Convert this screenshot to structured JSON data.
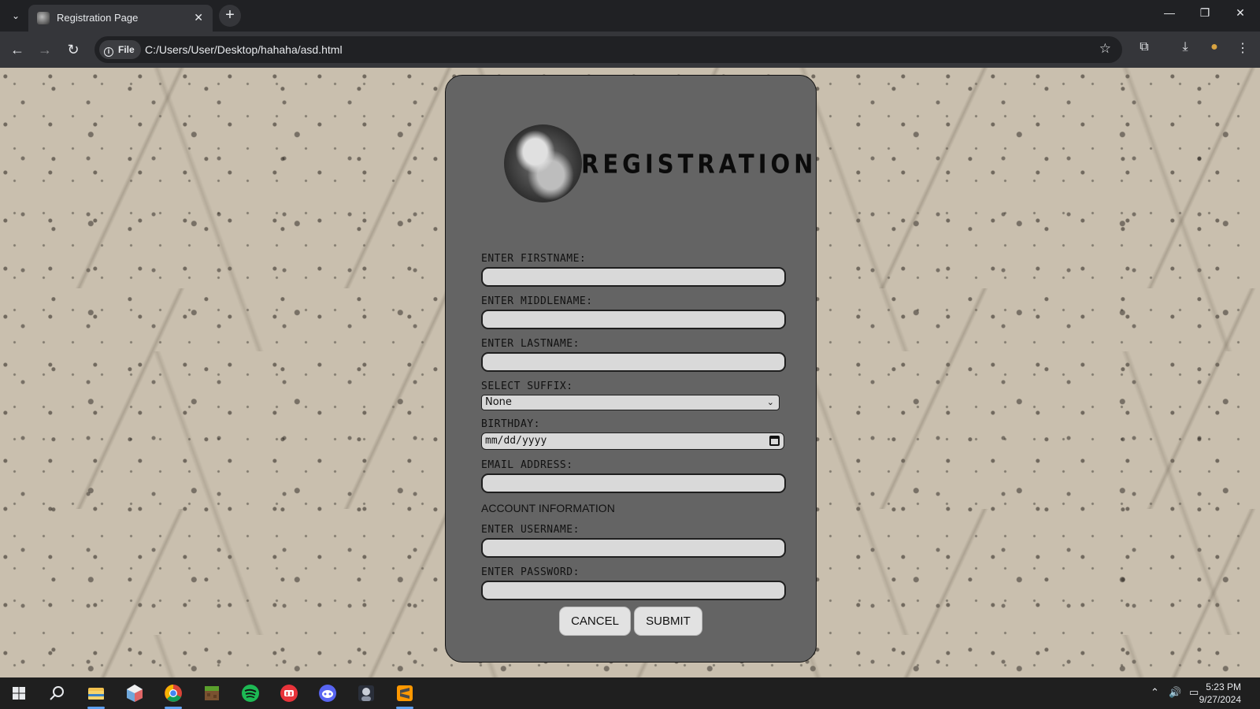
{
  "browser": {
    "tab": {
      "title": "Registration Page",
      "close_glyph": "✕"
    },
    "new_tab_glyph": "+",
    "tab_list_glyph": "⌄",
    "window_controls": {
      "minimize": "—",
      "maximize": "❐",
      "close": "✕"
    },
    "nav": {
      "back": "←",
      "forward": "→",
      "reload": "↻"
    },
    "site_chip": {
      "icon": "i",
      "label": "File"
    },
    "url": "C:/Users/User/Desktop/hahaha/asd.html",
    "bookmark_glyph": "☆",
    "toolbar_icons": {
      "extensions": "⧉",
      "downloads": "⤓",
      "profile": "●",
      "menu": "⋮"
    }
  },
  "form": {
    "brand_title": "REGISTRATION",
    "fields": [
      {
        "label": "ENTER FIRSTNAME:",
        "value": ""
      },
      {
        "label": "ENTER MIDDLENAME:",
        "value": ""
      },
      {
        "label": "ENTER LASTNAME:",
        "value": ""
      }
    ],
    "suffix": {
      "label": "SELECT SUFFIX:",
      "selected": "None"
    },
    "birthday": {
      "label": "BIRTHDAY:",
      "placeholder": "mm/dd/yyyy"
    },
    "email": {
      "label": "EMAIL ADDRESS:",
      "value": ""
    },
    "account_heading": "ACCOUNT INFORMATION",
    "username": {
      "label": "ENTER USERNAME:",
      "value": ""
    },
    "password": {
      "label": "ENTER PASSWORD:",
      "value": ""
    },
    "buttons": {
      "cancel": "CANCEL",
      "submit": "SUBMIT"
    }
  },
  "taskbar": {
    "apps": [
      "start",
      "search",
      "file-explorer",
      "app-cube",
      "chrome",
      "minecraft",
      "spotify",
      "app-red",
      "discord",
      "app-portrait",
      "sublime-text"
    ],
    "tray": {
      "chevron": "⌃",
      "volume": "🔊",
      "network": "▭"
    },
    "time": "5:23 PM",
    "date": "9/27/2024"
  },
  "colors": {
    "card_bg": "#646464",
    "input_bg": "#d9d9d9",
    "wall_bg": "#c9bfae",
    "chrome_dark": "#202124"
  }
}
